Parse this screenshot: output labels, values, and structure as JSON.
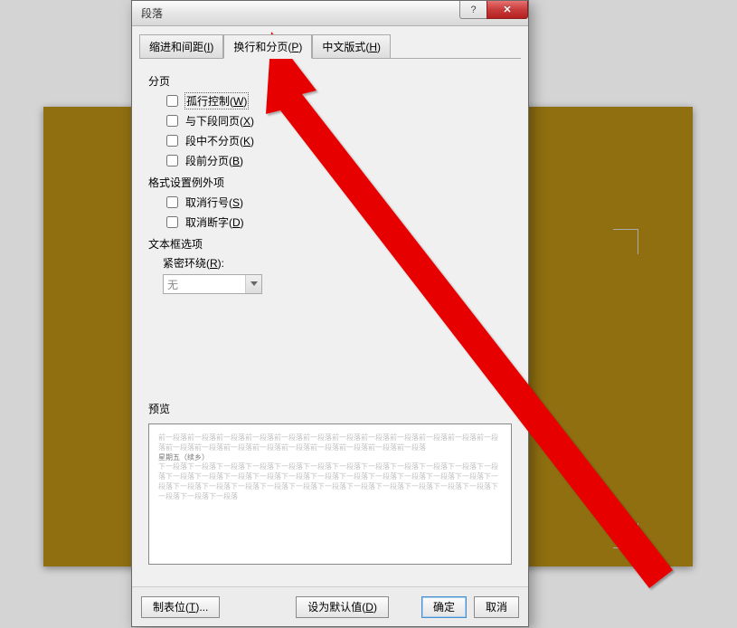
{
  "dialog": {
    "title": "段落",
    "help_btn": "?",
    "close_btn": "✕"
  },
  "tabs": {
    "indent": "缩进和间距(I)",
    "pagebreak": "换行和分页(P)",
    "chinese": "中文版式(H)"
  },
  "sections": {
    "pagination": "分页",
    "format_exceptions": "格式设置例外项",
    "textbox_options": "文本框选项",
    "preview": "预览"
  },
  "checkboxes": {
    "widow": "孤行控制(W)",
    "keepnext": "与下段同页(X)",
    "keeplines": "段中不分页(K)",
    "pagebreakbefore": "段前分页(B)",
    "suppress_lineno": "取消行号(S)",
    "no_hyphen": "取消断字(D)"
  },
  "tight_wrap": {
    "label": "紧密环绕(R):",
    "value": "无"
  },
  "preview_text": {
    "before": "前一段落前一段落前一段落前一段落前一段落前一段落前一段落前一段落前一段落前一段落前一段落前一段落前一段落前一段落前一段落前一段落前一段落前一段落前一段落前一段落前一段落",
    "sample": "星期五（续乡）",
    "after": "下一段落下一段落下一段落下一段落下一段落下一段落下一段落下一段落下一段落下一段落下一段落下一段落下一段落下一段落下一段落下一段落下一段落下一段落下一段落下一段落下一段落下一段落下一段落下一段落下一段落下一段落下一段落下一段落下一段落下一段落下一段落下一段落下一段落下一段落下一段落下一段落下一段落下一段落"
  },
  "buttons": {
    "tabs": "制表位(T)...",
    "default": "设为默认值(D)",
    "ok": "确定",
    "cancel": "取消"
  }
}
